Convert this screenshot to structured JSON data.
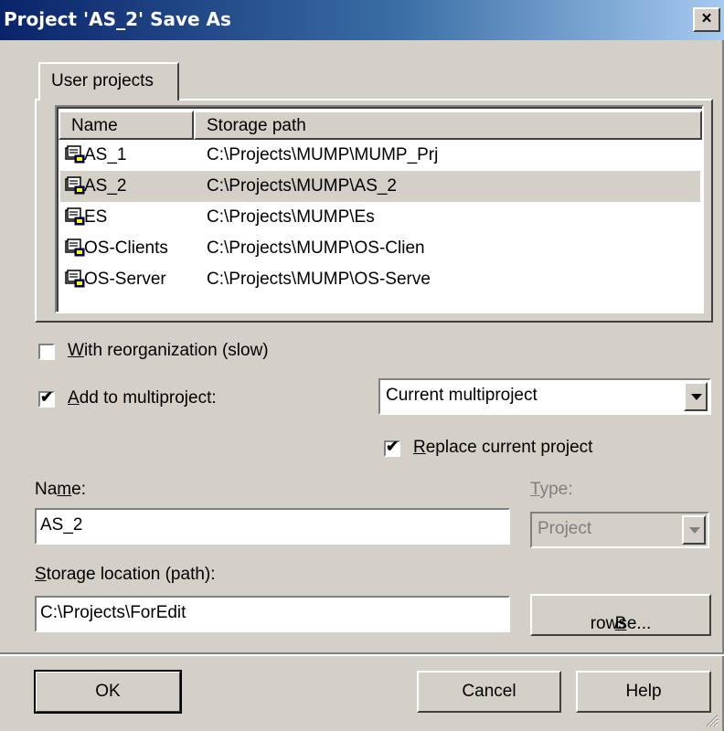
{
  "window": {
    "title": "Project 'AS_2' Save As",
    "close_label": "×"
  },
  "tab": {
    "label": "User projects"
  },
  "project_list": {
    "columns": [
      "Name",
      "Storage path"
    ],
    "rows": [
      {
        "name": "AS_1",
        "path": "C:\\Projects\\MUMP\\MUMP_Prj",
        "selected": false
      },
      {
        "name": "AS_2",
        "path": "C:\\Projects\\MUMP\\AS_2",
        "selected": true
      },
      {
        "name": "ES",
        "path": "C:\\Projects\\MUMP\\Es",
        "selected": false
      },
      {
        "name": "OS-Clients",
        "path": "C:\\Projects\\MUMP\\OS-Clien",
        "selected": false
      },
      {
        "name": "OS-Server",
        "path": "C:\\Projects\\MUMP\\OS-Serve",
        "selected": false
      }
    ]
  },
  "options": {
    "reorg": {
      "checked": false,
      "hotkey": "W",
      "rest": "ith reorganization (slow)"
    },
    "multiproject": {
      "checked": true,
      "hotkey": "A",
      "rest": "dd to multiproject:"
    },
    "multiproject_select": "Current multiproject",
    "replace": {
      "checked": true,
      "hotkey": "R",
      "rest": "eplace current project"
    }
  },
  "name_field": {
    "label_pre": "Na",
    "label_hot": "m",
    "label_post": "e:",
    "value": "AS_2"
  },
  "type_field": {
    "label_hot": "T",
    "label_post": "ype:",
    "value": "Project"
  },
  "storage": {
    "label_hot": "S",
    "label_post": "torage location (path):",
    "value": "C:\\Projects\\ForEdit"
  },
  "buttons": {
    "browse_hot": "B",
    "browse_post": "rowse...",
    "ok": "OK",
    "cancel": "Cancel",
    "help": "Help"
  },
  "colors": {
    "face": "#d4d0c8",
    "title_start": "#0a246a",
    "title_end": "#a6caf0"
  }
}
